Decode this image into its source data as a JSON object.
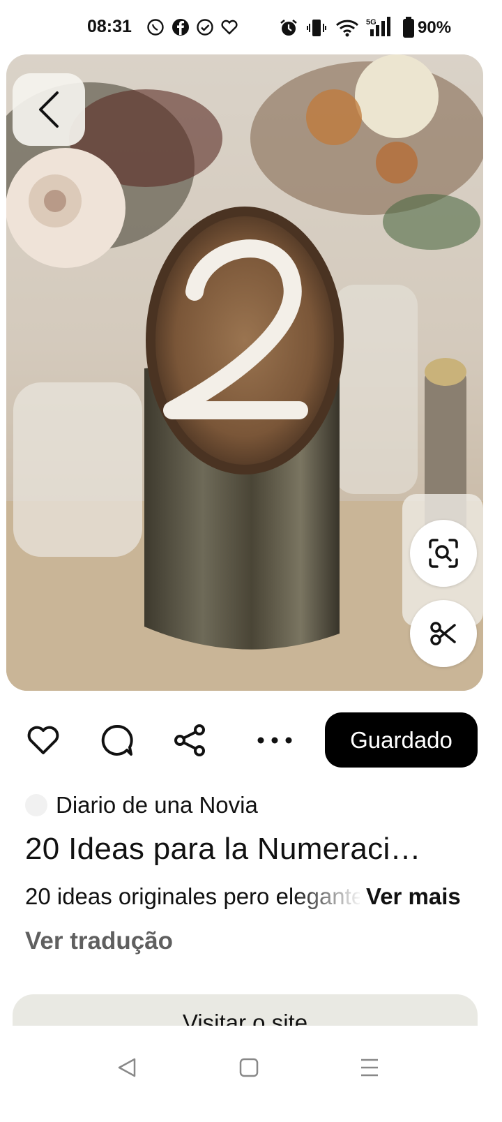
{
  "status_bar": {
    "time": "08:31",
    "battery": "90%",
    "icons": [
      "whatsapp-icon",
      "facebook-icon",
      "check-circle-icon",
      "heart-outline-icon",
      "alarm-icon",
      "vibrate-icon",
      "wifi-icon",
      "signal-5g-icon",
      "battery-icon"
    ]
  },
  "pin": {
    "image_alt": "Tree log table number 2 centerpiece",
    "actions": {
      "like_icon": "heart-icon",
      "comment_icon": "comment-icon",
      "share_icon": "share-icon",
      "more_icon": "more-icon",
      "saved_label": "Guardado"
    },
    "source_name": "Diario de una Novia",
    "title": "20 Ideas para la Numeraci…",
    "description": "20 ideas originales pero elegantes",
    "more_label": "Ver mais",
    "translate_label": "Ver tradução",
    "visit_label": "Visitar o site"
  },
  "nav": {
    "back_icon": "back-triangle-icon",
    "home_icon": "home-square-icon",
    "recents_icon": "menu-lines-icon"
  },
  "colors": {
    "saved_bg": "#000000",
    "visit_bg": "#e9e9e3",
    "secondary_text": "#5f5f5f"
  }
}
